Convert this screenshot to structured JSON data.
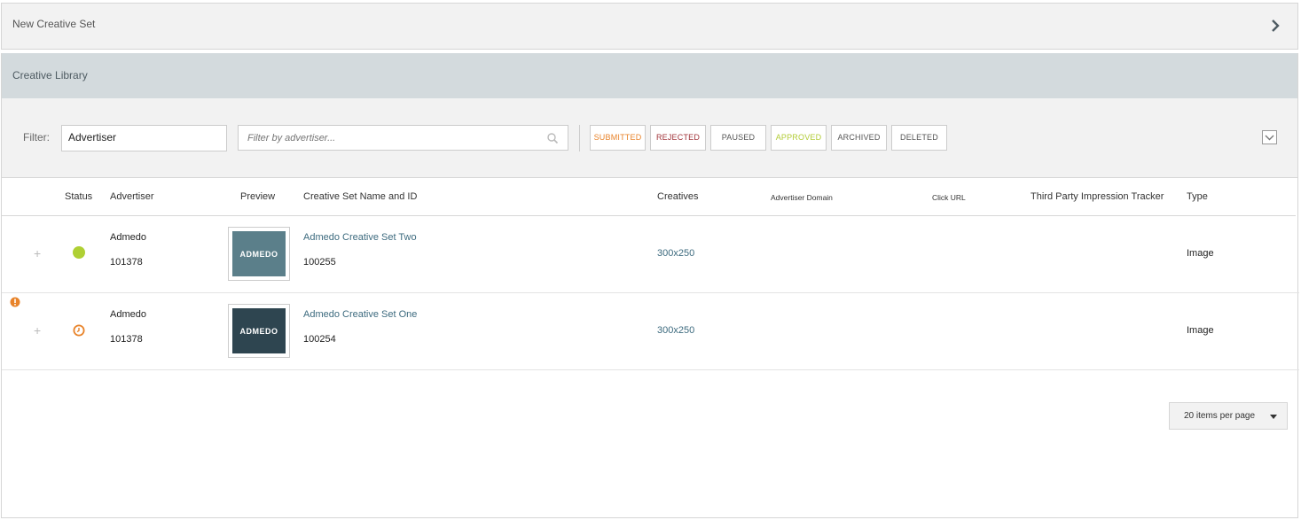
{
  "new_creative_set": {
    "title": "New Creative Set"
  },
  "creative_library": {
    "title": "Creative Library",
    "filter": {
      "label": "Filter:",
      "field_value": "Advertiser",
      "search_placeholder": "Filter by advertiser...",
      "chips": [
        "SUBMITTED",
        "REJECTED",
        "PAUSED",
        "APPROVED",
        "ARCHIVED",
        "DELETED"
      ]
    },
    "columns": {
      "status": "Status",
      "advertiser": "Advertiser",
      "preview": "Preview",
      "set_name": "Creative Set Name and ID",
      "creatives": "Creatives",
      "adv_domain": "Advertiser Domain",
      "click_url": "Click URL",
      "tracker": "Third Party Impression Tracker",
      "type": "Type"
    },
    "rows": [
      {
        "status": "approved",
        "advertiser": "Admedo",
        "advertiser_id": "101378",
        "preview_text": "ADMEDO",
        "preview_color": "#5b7f8a",
        "set_name": "Admedo Creative Set Two",
        "set_id": "100255",
        "creatives": "300x250",
        "type": "Image"
      },
      {
        "status": "submitted",
        "advertiser": "Admedo",
        "advertiser_id": "101378",
        "preview_text": "ADMEDO",
        "preview_color": "#2e4550",
        "set_name": "Admedo Creative Set One",
        "set_id": "100254",
        "creatives": "300x250",
        "type": "Image"
      }
    ],
    "pagination": {
      "label": "20 items per page"
    }
  },
  "colors": {
    "approved": "#afd034",
    "submitted": "#e8832a",
    "rejected": "#a1343a",
    "link": "#3c6a7e"
  }
}
